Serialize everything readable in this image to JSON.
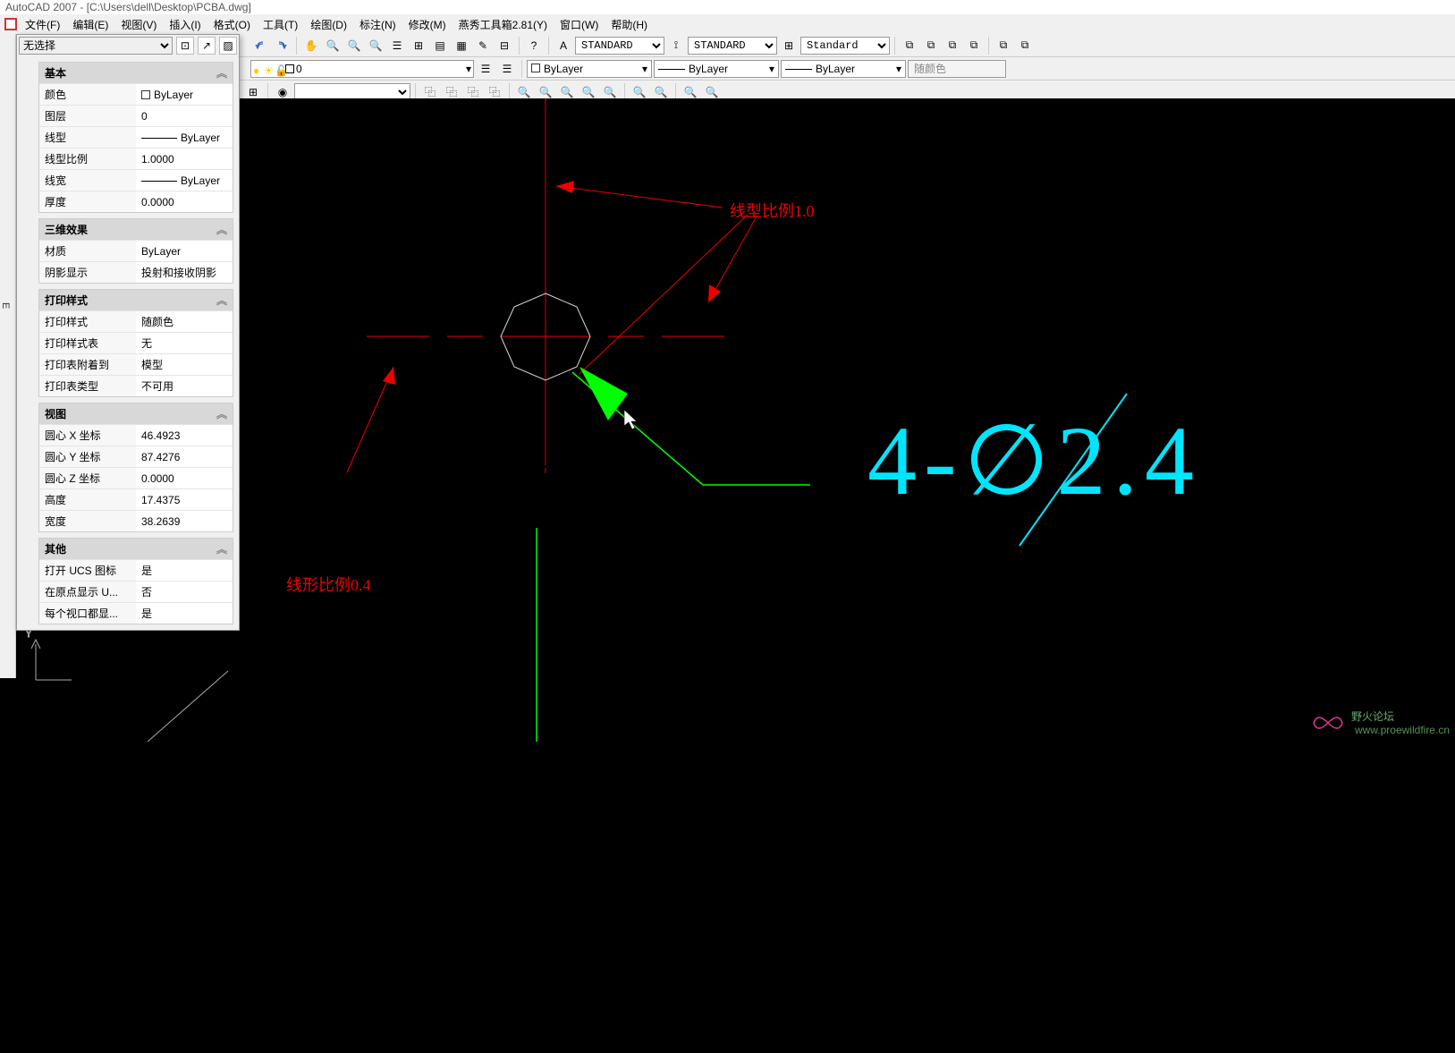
{
  "title": "AutoCAD 2007 - [C:\\Users\\dell\\Desktop\\PCBA.dwg]",
  "menus": {
    "file": "文件(F)",
    "edit": "编辑(E)",
    "view": "视图(V)",
    "insert": "插入(I)",
    "format": "格式(O)",
    "tools": "工具(T)",
    "draw": "绘图(D)",
    "dim": "标注(N)",
    "modify": "修改(M)",
    "yanxiu": "燕秀工具箱2.81(Y)",
    "window": "窗口(W)",
    "help": "帮助(H)"
  },
  "styles": {
    "text": "STANDARD",
    "dim": "STANDARD",
    "table": "Standard"
  },
  "layer": {
    "current": "0"
  },
  "bylayer": {
    "color": "ByLayer",
    "linetype": "ByLayer",
    "lineweight": "ByLayer",
    "followcolor": "随颜色"
  },
  "props": {
    "selector": "无选择",
    "groups": {
      "basic": {
        "title": "基本",
        "rows": [
          {
            "k": "颜色",
            "v": "ByLayer",
            "swatch": true
          },
          {
            "k": "图层",
            "v": "0"
          },
          {
            "k": "线型",
            "v": "ByLayer",
            "line": true
          },
          {
            "k": "线型比例",
            "v": "1.0000"
          },
          {
            "k": "线宽",
            "v": "ByLayer",
            "line": true
          },
          {
            "k": "厚度",
            "v": "0.0000"
          }
        ]
      },
      "threeD": {
        "title": "三维效果",
        "rows": [
          {
            "k": "材质",
            "v": "ByLayer"
          },
          {
            "k": "阴影显示",
            "v": "投射和接收阴影"
          }
        ]
      },
      "plot": {
        "title": "打印样式",
        "rows": [
          {
            "k": "打印样式",
            "v": "随颜色"
          },
          {
            "k": "打印样式表",
            "v": "无"
          },
          {
            "k": "打印表附着到",
            "v": "模型"
          },
          {
            "k": "打印表类型",
            "v": "不可用"
          }
        ]
      },
      "viewgrp": {
        "title": "视图",
        "rows": [
          {
            "k": "圆心 X 坐标",
            "v": "46.4923"
          },
          {
            "k": "圆心 Y 坐标",
            "v": "87.4276"
          },
          {
            "k": "圆心 Z 坐标",
            "v": "0.0000"
          },
          {
            "k": "高度",
            "v": "17.4375"
          },
          {
            "k": "宽度",
            "v": "38.2639"
          }
        ]
      },
      "other": {
        "title": "其他",
        "rows": [
          {
            "k": "打开 UCS 图标",
            "v": "是"
          },
          {
            "k": "在原点显示 U...",
            "v": "否"
          },
          {
            "k": "每个视口都显...",
            "v": "是"
          }
        ]
      }
    }
  },
  "canvas": {
    "annot1": "线型比例1.0",
    "annot2": "线形比例0.4",
    "dimension": "4-∅2.4"
  },
  "watermark": {
    "name": "野火论坛",
    "url": "www.proewildfire.cn"
  }
}
